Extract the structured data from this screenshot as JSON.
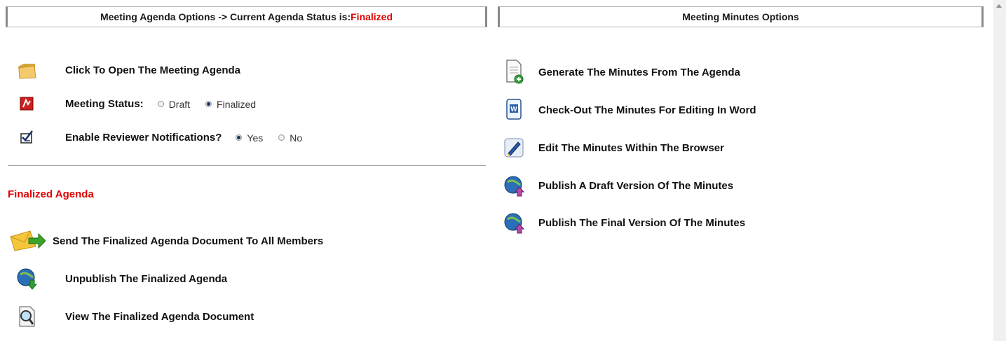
{
  "agenda_header": {
    "prefix": "Meeting Agenda Options -> Current Agenda Status is: ",
    "status": "Finalized"
  },
  "minutes_header": {
    "title": "Meeting Minutes Options"
  },
  "agenda_options": {
    "open_agenda": "Click To Open The Meeting Agenda",
    "meeting_status": {
      "label": "Meeting Status:",
      "options": [
        "Draft",
        "Finalized"
      ],
      "selected": "Finalized"
    },
    "reviewer_notifications": {
      "label": "Enable Reviewer Notifications?",
      "options": [
        "Yes",
        "No"
      ],
      "selected": "Yes"
    }
  },
  "finalized_section": {
    "title": "Finalized Agenda",
    "actions": [
      {
        "label": "Send The Finalized Agenda Document To All Members",
        "icon": "envelope-send-icon"
      },
      {
        "label": "Unpublish The Finalized Agenda",
        "icon": "globe-down-icon"
      },
      {
        "label": "View The Finalized Agenda Document",
        "icon": "magnifier-document-icon"
      }
    ]
  },
  "minutes_options": [
    {
      "label": "Generate The Minutes From The Agenda",
      "icon": "document-add-icon"
    },
    {
      "label": "Check-Out The Minutes For Editing In Word",
      "icon": "word-document-icon"
    },
    {
      "label": "Edit The Minutes Within The Browser",
      "icon": "edit-pen-icon"
    },
    {
      "label": "Publish A Draft Version Of The Minutes",
      "icon": "globe-up-icon"
    },
    {
      "label": "Publish The Final Version Of The Minutes",
      "icon": "globe-up-icon"
    }
  ],
  "colors": {
    "status_red": "#e00000",
    "header_border": "#8a8a8a"
  }
}
